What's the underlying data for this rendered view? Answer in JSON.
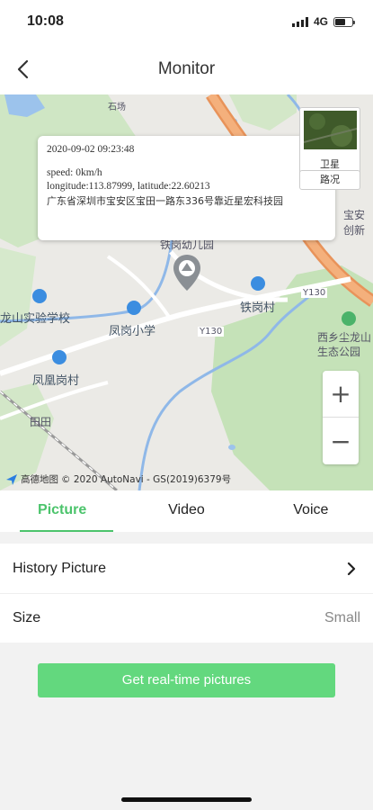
{
  "status_bar": {
    "time": "10:08",
    "network": "4G",
    "battery_level": 0.6
  },
  "nav": {
    "title": "Monitor",
    "back_icon": "chevron-left-icon"
  },
  "map": {
    "info": {
      "datetime": "2020-09-02 09:23:48",
      "speed": "speed: 0km/h",
      "coords": "longitude:113.87999, latitude:22.60213",
      "address": "广东省深圳市宝安区宝田一路东336号靠近星宏科技园"
    },
    "satellite_label": "卫星",
    "traffic_label": "路况",
    "labels": {
      "kindergarten": "铁岗幼儿园",
      "school_1": "龙山实验学校",
      "school_2": "凤岗小学",
      "village_1": "铁岗村",
      "village_2": "凤凰岗村",
      "park": "西乡尘龙山生态公园",
      "road_1": "Y130",
      "road_2": "Y130",
      "area": "宝安创新",
      "place": "田田",
      "top_label": "石场"
    },
    "copyright": "© 2020 AutoNavi - GS(2019)6379号",
    "brand": "高德地图"
  },
  "tabs": [
    {
      "label": "Picture",
      "active": true
    },
    {
      "label": "Video",
      "active": false
    },
    {
      "label": "Voice",
      "active": false
    }
  ],
  "list": {
    "history_label": "History Picture",
    "size_label": "Size",
    "size_value": "Small"
  },
  "action": {
    "label": "Get real-time pictures"
  },
  "colors": {
    "accent": "#4cc46c",
    "button": "#63d87e"
  }
}
